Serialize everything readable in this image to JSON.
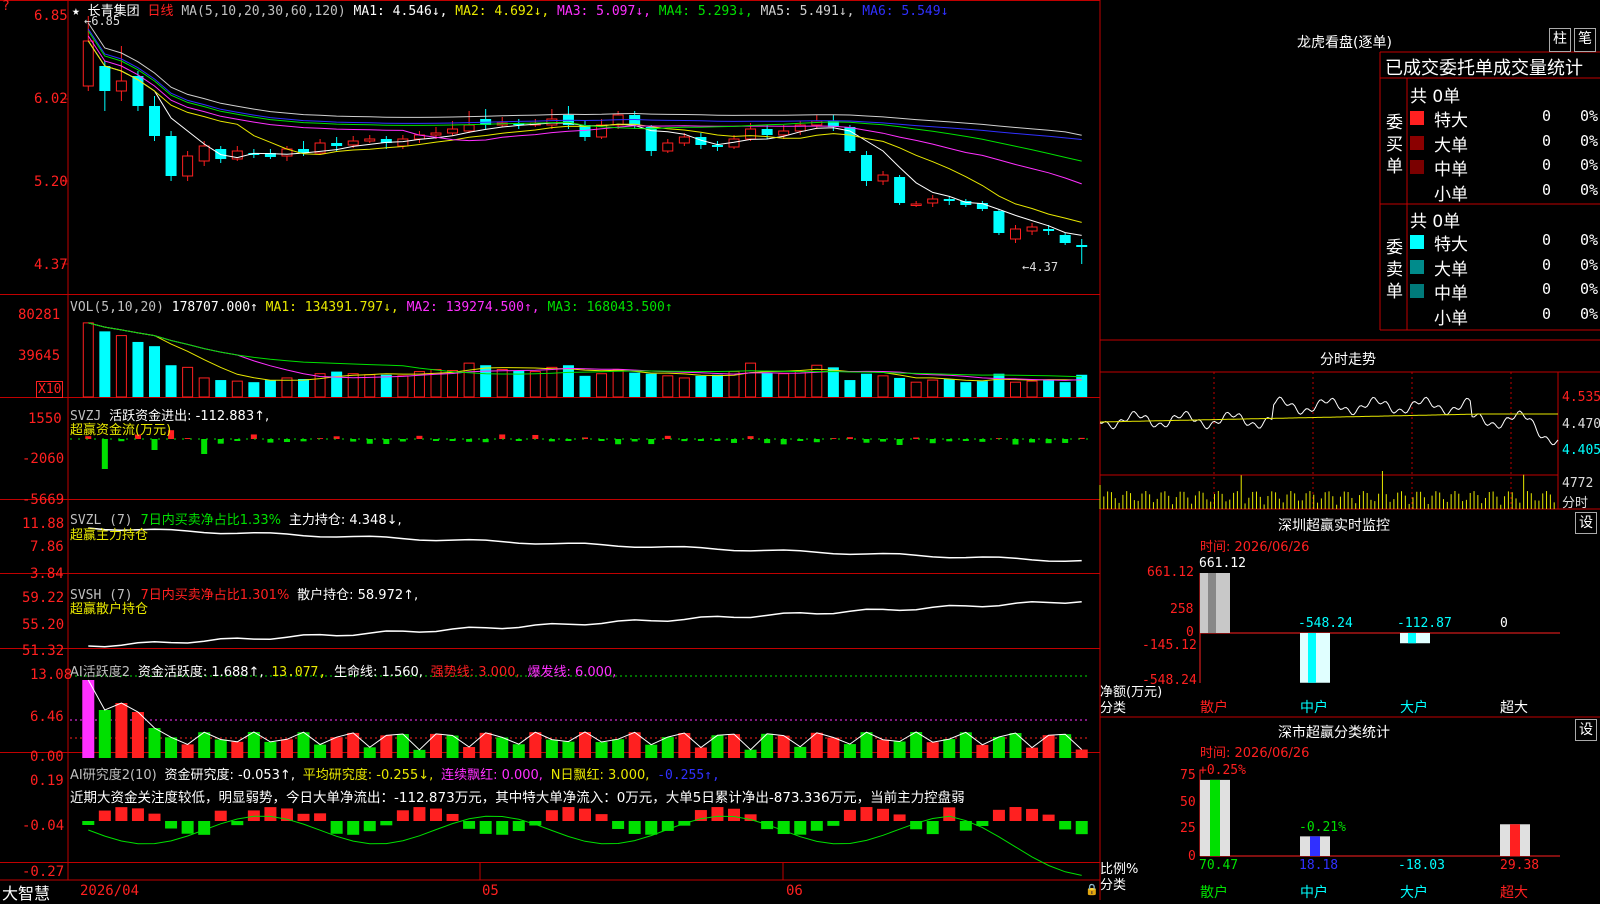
{
  "colors": {
    "up": "#ff2020",
    "down": "#00ffff",
    "grid": "#c00000",
    "ma1": "#ffffff",
    "ma2": "#e8e800",
    "ma3": "#ff30ff",
    "ma4": "#00e000",
    "ma5": "#d0d0d0",
    "ma6": "#3030ff"
  },
  "header": {
    "star": "★",
    "stock_name": "长青集团",
    "period": "日线",
    "ma_params": "MA(5,10,20,30,60,120)",
    "ma1": "MA1: 4.546↓,",
    "ma2": "MA2: 4.692↓,",
    "ma3": "MA3: 5.097↓,",
    "ma4": "MA4: 5.293↓,",
    "ma5": "MA5: 5.491↓,",
    "ma6": "MA6: 5.549↓",
    "high_mark": "←6.85",
    "low_mark": "←4.37"
  },
  "price_axis": [
    "6.85",
    "6.02",
    "5.20",
    "4.37"
  ],
  "vol": {
    "label": "VOL(5,10,20)",
    "value": "178707.000↑",
    "ma1": "MA1: 134391.797↓,",
    "ma2": "MA2: 139274.500↑,",
    "ma3": "MA3: 168043.500↑",
    "axis": [
      "80281",
      "39645"
    ],
    "unit": "X10"
  },
  "svzj": {
    "label": "SVZJ",
    "value_label": "活跃资金进出: -112.883↑,",
    "sub": "超赢资金流(万元)",
    "axis": [
      "1550",
      "-2060",
      "-5669"
    ]
  },
  "svzl": {
    "label": "SVZL (7)",
    "desc": "7日内买卖净占比1.33%",
    "hold": "主力持仓: 4.348↓,",
    "sub": "超赢主力持仓",
    "axis": [
      "11.88",
      "7.86",
      "3.84"
    ]
  },
  "svsh": {
    "label": "SVSH (7)",
    "desc": "7日内买卖净占比1.301%",
    "hold": "散户持仓: 58.972↑,",
    "sub": "超赢散户持仓",
    "axis": [
      "59.22",
      "55.20",
      "51.32"
    ]
  },
  "ai1": {
    "label": "AI活跃度2",
    "active": "资金活跃度: 1.688↑,",
    "v2": "13.077,",
    "life": "生命线: 1.560,",
    "strong": "强势线: 3.000,",
    "burst": "爆发线: 6.000,",
    "axis": [
      "13.08",
      "6.46",
      "0.00"
    ]
  },
  "ai2": {
    "label": "AI研究度2(10)",
    "research": "资金研究度: -0.053↑,",
    "avg": "平均研究度: -0.255↓,",
    "cont": "连续飘红: 0.000,",
    "nday": "N日飘红: 3.000,",
    "last": "-0.255↑,",
    "comment": "近期大资金关注度较低，明显弱势，今日大单净流出：-112.873万元，其中特大单净流入：0万元，大单5日累计净出-873.336万元，当前主力控盘弱",
    "axis": [
      "0.19",
      "-0.04",
      "-0.27"
    ]
  },
  "date_axis": {
    "d1": "2026/04",
    "d2": "05",
    "d3": "06"
  },
  "brand": "大智慧",
  "lhb": {
    "title": "龙虎看盘(逐单)",
    "btn1": "柱",
    "btn2": "笔",
    "tabs": [
      "已成交",
      "委托单",
      "成交量统计"
    ],
    "buy_label": "委买单",
    "sell_label": "委卖单",
    "buy_total": "共 0单",
    "sell_total": "共 0单",
    "buy_rows": [
      {
        "name": "特大",
        "v": "0",
        "p": "0%"
      },
      {
        "name": "大单",
        "v": "0",
        "p": "0%"
      },
      {
        "name": "中单",
        "v": "0",
        "p": "0%"
      },
      {
        "name": "小单",
        "v": "0",
        "p": "0%"
      }
    ],
    "sell_rows": [
      {
        "name": "特大",
        "v": "0",
        "p": "0%"
      },
      {
        "name": "大单",
        "v": "0",
        "p": "0%"
      },
      {
        "name": "中单",
        "v": "0",
        "p": "0%"
      },
      {
        "name": "小单",
        "v": "0",
        "p": "0%"
      }
    ]
  },
  "fenshi": {
    "title": "分时走势",
    "axis": [
      "4.535",
      "4.470",
      "4.405"
    ],
    "vol": "4772",
    "vol_label": "分时"
  },
  "monitor": {
    "title": "深圳超赢实时监控",
    "btn": "设",
    "time": "时间: 2026/06/26",
    "axis": [
      "661.12",
      "258",
      "0",
      "-145.12",
      "-548.24"
    ],
    "unit": "净额(万元)",
    "cat_label": "分类",
    "labels": [
      "661.12",
      "-548.24",
      "-112.87",
      "0"
    ],
    "cats": [
      "散户",
      "中户",
      "大户",
      "超大"
    ],
    "values": [
      661.12,
      -548.24,
      -112.87,
      0
    ]
  },
  "classify": {
    "title": "深市超赢分类统计",
    "btn": "设",
    "time": "时间: 2026/06/26",
    "axis": [
      "75",
      "50",
      "25",
      "0"
    ],
    "unit": "比例%",
    "cat_label": "分类",
    "top_labels": [
      "+0.25%",
      "-0.21%"
    ],
    "bottom": [
      "70.47",
      "18.18",
      "-18.03",
      "29.38"
    ],
    "cats": [
      "散户",
      "中户",
      "大户",
      "超大"
    ],
    "values": [
      70.47,
      18.18,
      0,
      29.38
    ]
  },
  "chart_data": {
    "type": "candlestick",
    "x_start": "2026/04",
    "ylim": [
      4.37,
      6.85
    ],
    "ohlc": [
      [
        6.15,
        6.6,
        6.85,
        6.1
      ],
      [
        6.35,
        6.1,
        6.4,
        5.9
      ],
      [
        6.1,
        6.2,
        6.55,
        6.0
      ],
      [
        6.25,
        5.95,
        6.3,
        5.9
      ],
      [
        5.95,
        5.65,
        6.05,
        5.6
      ],
      [
        5.65,
        5.25,
        5.7,
        5.2
      ],
      [
        5.25,
        5.45,
        5.5,
        5.2
      ],
      [
        5.4,
        5.55,
        5.6,
        5.35
      ],
      [
        5.52,
        5.42,
        5.55,
        5.38
      ],
      [
        5.42,
        5.5,
        5.55,
        5.4
      ],
      [
        5.48,
        5.46,
        5.52,
        5.43
      ],
      [
        5.48,
        5.44,
        5.52,
        5.42
      ],
      [
        5.45,
        5.52,
        5.55,
        5.4
      ],
      [
        5.52,
        5.48,
        5.6,
        5.45
      ],
      [
        5.48,
        5.58,
        5.62,
        5.46
      ],
      [
        5.58,
        5.55,
        5.64,
        5.5
      ],
      [
        5.56,
        5.6,
        5.65,
        5.53
      ],
      [
        5.6,
        5.62,
        5.66,
        5.58
      ],
      [
        5.62,
        5.58,
        5.65,
        5.52
      ],
      [
        5.55,
        5.62,
        5.66,
        5.52
      ],
      [
        5.62,
        5.66,
        5.7,
        5.58
      ],
      [
        5.66,
        5.68,
        5.74,
        5.62
      ],
      [
        5.68,
        5.72,
        5.8,
        5.65
      ],
      [
        5.7,
        5.76,
        5.9,
        5.68
      ],
      [
        5.82,
        5.76,
        5.92,
        5.72
      ],
      [
        5.76,
        5.78,
        5.84,
        5.74
      ],
      [
        5.78,
        5.76,
        5.82,
        5.72
      ],
      [
        5.76,
        5.78,
        5.82,
        5.74
      ],
      [
        5.76,
        5.82,
        5.92,
        5.72
      ],
      [
        5.86,
        5.76,
        5.95,
        5.72
      ],
      [
        5.76,
        5.64,
        5.8,
        5.6
      ],
      [
        5.64,
        5.76,
        5.82,
        5.62
      ],
      [
        5.76,
        5.86,
        5.9,
        5.72
      ],
      [
        5.86,
        5.76,
        5.9,
        5.72
      ],
      [
        5.74,
        5.5,
        5.76,
        5.45
      ],
      [
        5.5,
        5.58,
        5.62,
        5.48
      ],
      [
        5.58,
        5.64,
        5.68,
        5.55
      ],
      [
        5.64,
        5.56,
        5.68,
        5.52
      ],
      [
        5.56,
        5.54,
        5.6,
        5.5
      ],
      [
        5.54,
        5.62,
        5.66,
        5.52
      ],
      [
        5.62,
        5.72,
        5.78,
        5.6
      ],
      [
        5.72,
        5.66,
        5.76,
        5.62
      ],
      [
        5.66,
        5.7,
        5.76,
        5.62
      ],
      [
        5.7,
        5.76,
        5.8,
        5.66
      ],
      [
        5.76,
        5.8,
        5.86,
        5.72
      ],
      [
        5.8,
        5.74,
        5.86,
        5.7
      ],
      [
        5.74,
        5.5,
        5.76,
        5.48
      ],
      [
        5.46,
        5.2,
        5.5,
        5.15
      ],
      [
        5.2,
        5.26,
        5.3,
        5.16
      ],
      [
        5.24,
        4.98,
        5.26,
        4.96
      ],
      [
        4.96,
        4.97,
        5.0,
        4.94
      ],
      [
        4.98,
        5.02,
        5.06,
        4.94
      ],
      [
        5.02,
        5.0,
        5.04,
        4.96
      ],
      [
        5.0,
        4.96,
        5.02,
        4.94
      ],
      [
        4.98,
        4.92,
        5.0,
        4.9
      ],
      [
        4.9,
        4.68,
        4.92,
        4.66
      ],
      [
        4.62,
        4.72,
        4.76,
        4.58
      ],
      [
        4.7,
        4.74,
        4.78,
        4.66
      ],
      [
        4.72,
        4.7,
        4.76,
        4.66
      ],
      [
        4.66,
        4.58,
        4.68,
        4.56
      ],
      [
        4.56,
        4.54,
        4.62,
        4.37
      ]
    ],
    "volume": [
      70000,
      62000,
      58000,
      52000,
      48000,
      30000,
      28000,
      18000,
      16000,
      15000,
      14000,
      16000,
      18000,
      17000,
      22000,
      24000,
      22000,
      21000,
      21000,
      20000,
      24000,
      26000,
      25000,
      32000,
      30000,
      26000,
      25000,
      24000,
      28000,
      30000,
      20000,
      22000,
      26000,
      23000,
      22000,
      20000,
      18000,
      20000,
      21000,
      24000,
      32000,
      23000,
      22000,
      24000,
      30000,
      28000,
      16000,
      22000,
      20000,
      18000,
      14000,
      16000,
      17000,
      14000,
      15000,
      22000,
      14000,
      15000,
      16000,
      14000,
      21000
    ]
  }
}
